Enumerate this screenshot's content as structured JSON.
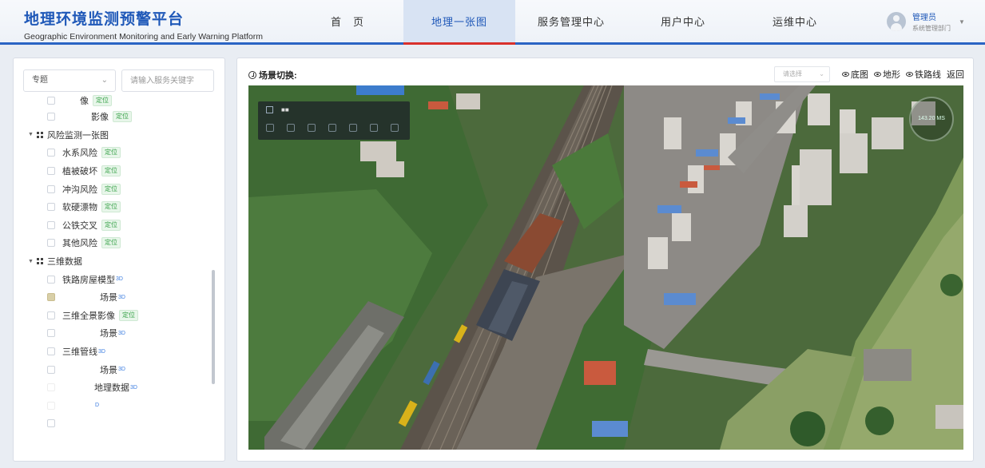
{
  "header": {
    "title_cn": "地理环境监测预警平台",
    "title_en": "Geographic Environment Monitoring and Early Warning Platform",
    "nav": [
      {
        "label": "首　页",
        "active": false
      },
      {
        "label": "地理一张图",
        "active": true
      },
      {
        "label": "服务管理中心",
        "active": false
      },
      {
        "label": "用户中心",
        "active": false
      },
      {
        "label": "运维中心",
        "active": false
      }
    ],
    "user": {
      "name": "管理员",
      "dept": "系统管理部门"
    }
  },
  "sidebar": {
    "topic_select": "专题",
    "search_placeholder": "请输入服务关键字",
    "tree": [
      {
        "kind": "child",
        "label": "像",
        "tag": "定位",
        "partial": true
      },
      {
        "kind": "child",
        "label": "影像",
        "tag": "定位"
      },
      {
        "kind": "group",
        "label": "风险监测一张图"
      },
      {
        "kind": "child",
        "label": "水系风险",
        "tag": "定位"
      },
      {
        "kind": "child",
        "label": "植被破坏",
        "tag": "定位"
      },
      {
        "kind": "child",
        "label": "冲沟风险",
        "tag": "定位"
      },
      {
        "kind": "child",
        "label": "软硬漂物",
        "tag": "定位"
      },
      {
        "kind": "child",
        "label": "公铁交叉",
        "tag": "定位"
      },
      {
        "kind": "child",
        "label": "其他风险",
        "tag": "定位"
      },
      {
        "kind": "group",
        "label": "三维数据"
      },
      {
        "kind": "child",
        "label": "铁路房屋模型",
        "tag3d": "3D"
      },
      {
        "kind": "child",
        "label": "场景",
        "tag3d": "3D",
        "checked": true,
        "indent": true
      },
      {
        "kind": "child",
        "label": "三维全景影像",
        "tag": "定位"
      },
      {
        "kind": "child",
        "label": "场景",
        "tag3d": "3D",
        "indent": true
      },
      {
        "kind": "child",
        "label": "三维管线",
        "tag3d": "3D"
      },
      {
        "kind": "child",
        "label": "场景",
        "tag3d": "3D",
        "indent": true
      },
      {
        "kind": "child",
        "label": "地理数据",
        "tag3d": "3D",
        "indent": true,
        "hide_cb": true
      },
      {
        "kind": "child",
        "label": "",
        "tag3d": "D",
        "hide_cb": true
      },
      {
        "kind": "child",
        "label": ""
      }
    ]
  },
  "viewer": {
    "scene_switch_label": "场景切换:",
    "select_placeholder": "请选择",
    "tools": [
      "底图",
      "地形",
      "铁路线",
      "返回"
    ],
    "compass_text": "143.20 MS",
    "overlay_title": "■■"
  }
}
